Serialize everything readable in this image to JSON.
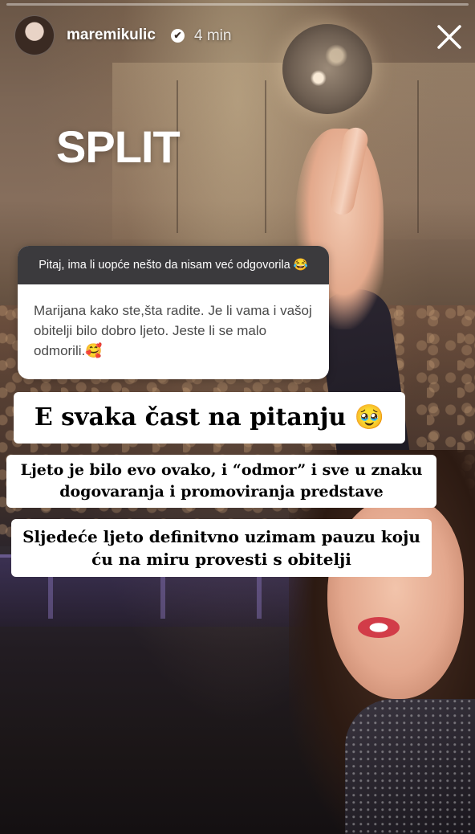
{
  "story": {
    "username": "maremikulic",
    "time_ago": "4 min",
    "close_symbol": "✕",
    "verified_symbol": "✔",
    "city": "SPLIT"
  },
  "question": {
    "prompt": "Pitaj, ima li uopće nešto da nisam već odgovorila 😂",
    "body": "Marijana kako ste,šta radite. Je li vama i vašoj obitelji bilo dobro ljeto. Jeste li se malo odmorili.🥰"
  },
  "captions": {
    "line1": "E svaka čast na pitanju 🥹",
    "line2": "Ljeto je bilo evo ovako, i “odmor” i sve u znaku dogovaranja i promoviranja predstave",
    "line3": "Sljedeće ljeto definitvno uzimam pauzu koju ću na miru provesti s obitelji"
  },
  "colors": {
    "question_header_bg": "#3b3a3d",
    "caption_bg": "#ffffff",
    "lipstick": "#d23c48"
  }
}
